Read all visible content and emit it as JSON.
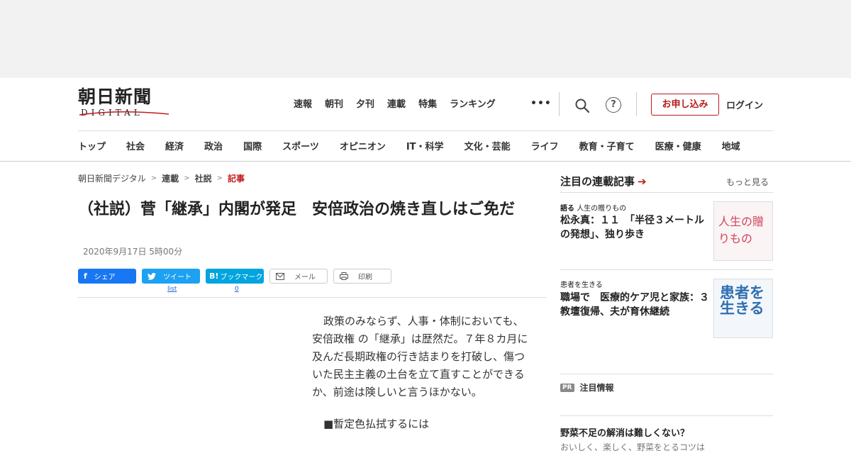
{
  "header": {
    "logo_jp": "朝日新聞",
    "logo_en": "DIGITAL",
    "topnav": [
      "速報",
      "朝刊",
      "夕刊",
      "連載",
      "特集",
      "ランキング"
    ],
    "more_dots": "•••",
    "help_glyph": "?",
    "apply_label": "お申し込み",
    "login_label": "ログイン",
    "categories": [
      "トップ",
      "社会",
      "経済",
      "政治",
      "国際",
      "スポーツ",
      "オピニオン",
      "IT・科学",
      "文化・芸能",
      "ライフ",
      "教育・子育て",
      "医療・健康",
      "地域"
    ]
  },
  "breadcrumb": {
    "items": [
      "朝日新聞デジタル",
      "連載",
      "社説"
    ],
    "current": "記事",
    "separator": ">"
  },
  "article": {
    "title": "（社説）菅「継承」内閣が発足　安倍政治の焼き直しはご免だ",
    "date": "2020年9月17日 5時00分",
    "share": {
      "facebook": "シェア",
      "twitter": "ツイート",
      "hatena_icon": "B!",
      "hatena": "ブックマーク",
      "mail": "メール",
      "print": "印刷",
      "twitter_count": "list",
      "hatena_count": "0"
    },
    "paragraph": "政策のみならず、人事・体制においても、 安倍政権 の「継承」は歴然だ。７年８カ月に及んだ長期政権の行き詰まりを打破し、傷ついた民主主義の土台を立て直すことができるか、前途は険しいと言うほかない。",
    "subheading": "■暫定色払拭するには"
  },
  "sidebar": {
    "heading": "注目の連載記事",
    "arrow": "➔",
    "more": "もっと見る",
    "cards": [
      {
        "label_strong": "語る",
        "label": "人生の贈りもの",
        "title": "松永真：１１　「半径３メートルの発想」、独り歩き",
        "thumb_text": "人生の贈りもの"
      },
      {
        "label_strong": "",
        "label": "患者を生きる",
        "title": "職場で　医療的ケア児と家族：３　教壇復帰、夫が育休継続",
        "thumb_text": "患者を生きる"
      }
    ],
    "pr_badge": "PR",
    "pr_label": "注目情報",
    "ad_title": "野菜不足の解消は難しくない？",
    "ad_cut": "おいしく、楽しく、野菜をとるコツは"
  },
  "colors": {
    "accent_red": "#c41a1a",
    "facebook": "#1877f2",
    "twitter": "#1da1f2",
    "hatena": "#00a4de"
  }
}
